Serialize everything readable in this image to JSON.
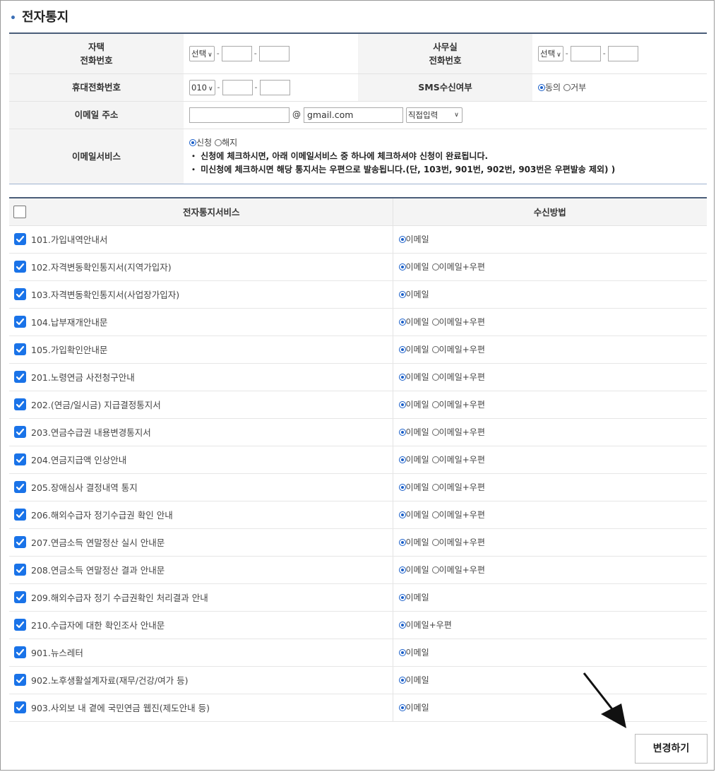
{
  "page": {
    "title": "전자통지"
  },
  "phone": {
    "home_label_1": "자택",
    "home_label_2": "전화번호",
    "home_area": "선택",
    "office_label_1": "사무실",
    "office_label_2": "전화번호",
    "office_area": "선택",
    "mobile_label": "휴대전화번호",
    "mobile_prefix": "010",
    "sms_label": "SMS수신여부",
    "sms_agree": "동의",
    "sms_reject": "거부"
  },
  "email": {
    "label": "이메일 주소",
    "user": "",
    "at": "@",
    "domain": "gmail.com",
    "domain_select": "직접입력"
  },
  "email_service": {
    "label": "이메일서비스",
    "apply": "신청",
    "cancel": "해지",
    "note1": "・ 신청에 체크하시면, 아래 이메일서비스 중 하나에 체크하셔야 신청이 완료됩니다.",
    "note2": "・ 미신청에 체크하시면 해당 통지서는 우편으로 발송됩니다.(단, 103번, 901번, 902번, 903번은 우편발송 제외) )"
  },
  "services": {
    "header_service": "전자통지서비스",
    "header_method": "수신방법",
    "opt_email": "이메일",
    "opt_email_post": "이메일+우편",
    "rows": [
      {
        "name": "101.가입내역안내서",
        "mode": "email"
      },
      {
        "name": "102.자격변동확인통지서(지역가입자)",
        "mode": "both"
      },
      {
        "name": "103.자격변동확인통지서(사업장가입자)",
        "mode": "email"
      },
      {
        "name": "104.납부재개안내문",
        "mode": "both"
      },
      {
        "name": "105.가입확인안내문",
        "mode": "both"
      },
      {
        "name": "201.노령연금 사전청구안내",
        "mode": "both"
      },
      {
        "name": "202.(연금/일시금) 지급결정통지서",
        "mode": "both"
      },
      {
        "name": "203.연금수급권 내용변경통지서",
        "mode": "both"
      },
      {
        "name": "204.연금지급액 인상안내",
        "mode": "both"
      },
      {
        "name": "205.장애심사 결정내역 통지",
        "mode": "both"
      },
      {
        "name": "206.해외수급자 정기수급권 확인 안내",
        "mode": "both"
      },
      {
        "name": "207.연금소득 연말정산 실시 안내문",
        "mode": "both"
      },
      {
        "name": "208.연금소득 연말정산 결과 안내문",
        "mode": "both"
      },
      {
        "name": "209.해외수급자 정기 수급권확인 처리결과 안내",
        "mode": "email"
      },
      {
        "name": "210.수급자에 대한 확인조사 안내문",
        "mode": "post"
      },
      {
        "name": "901.뉴스레터",
        "mode": "email"
      },
      {
        "name": "902.노후생활설계자료(재무/건강/여가 등)",
        "mode": "email"
      },
      {
        "name": "903.사외보 내 곁에 국민연금 웹진(제도안내 등)",
        "mode": "email"
      }
    ]
  },
  "actions": {
    "submit": "변경하기"
  },
  "colors": {
    "accent": "#1a73e8",
    "header_line": "#4a5d79"
  }
}
